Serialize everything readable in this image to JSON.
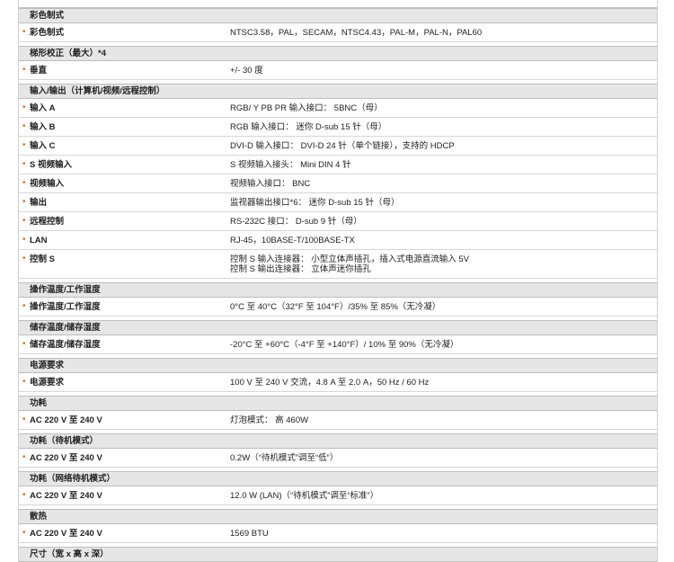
{
  "sections": [
    {
      "title": "彩色制式",
      "rows": [
        {
          "label": "彩色制式",
          "value": [
            "NTSC3.58，PAL，SECAM，NTSC4.43，PAL-M，PAL-N，PAL60"
          ]
        }
      ]
    },
    {
      "title": "梯形校正（最大）*4",
      "rows": [
        {
          "label": "垂直",
          "value": [
            "+/- 30 度"
          ]
        }
      ]
    },
    {
      "title": "输入/输出（计算机/视频/远程控制）",
      "rows": [
        {
          "label": "输入 A",
          "value": [
            "RGB/ Y PB PR 输入接口： 5BNC（母）"
          ]
        },
        {
          "label": "输入 B",
          "value": [
            "RGB 输入接口： 迷你 D-sub 15 针（母）"
          ]
        },
        {
          "label": "输入 C",
          "value": [
            "DVI-D 输入接口： DVI-D 24 针（单个链接），支持的 HDCP"
          ]
        },
        {
          "label": "S 视频输入",
          "value": [
            "S 视频输入接头： Mini DIN 4 针"
          ]
        },
        {
          "label": "视频输入",
          "value": [
            "视频输入接口： BNC"
          ]
        },
        {
          "label": "输出",
          "value": [
            "监视器输出接口*6： 迷你 D-sub 15 针（母）"
          ]
        },
        {
          "label": "远程控制",
          "value": [
            "RS-232C 接口： D-sub 9 针（母）"
          ]
        },
        {
          "label": "LAN",
          "value": [
            "RJ-45，10BASE-T/100BASE-TX"
          ]
        },
        {
          "label": "控制 S",
          "value": [
            "控制 S 输入连接器： 小型立体声插孔，插入式电源直流输入 5V",
            "控制 S 输出连接器： 立体声迷你插孔"
          ]
        }
      ]
    },
    {
      "title": "操作温度/工作湿度",
      "rows": [
        {
          "label": "操作温度/工作湿度",
          "value": [
            "0°C 至 40°C（32°F 至 104°F）/35% 至 85%（无冷凝）"
          ]
        }
      ]
    },
    {
      "title": "储存温度/储存湿度",
      "rows": [
        {
          "label": "储存温度/储存湿度",
          "value": [
            "-20°C 至 +60°C（-4°F 至 +140°F）/ 10% 至 90%（无冷凝）"
          ]
        }
      ]
    },
    {
      "title": "电源要求",
      "rows": [
        {
          "label": "电源要求",
          "value": [
            "100 V 至 240 V 交流，4.8 A 至 2.0 A，50 Hz / 60 Hz"
          ]
        }
      ]
    },
    {
      "title": "功耗",
      "rows": [
        {
          "label": "AC 220 V 至 240 V",
          "value": [
            "灯泡模式： 高 460W"
          ]
        }
      ]
    },
    {
      "title": "功耗（待机模式）",
      "rows": [
        {
          "label": "AC 220 V 至 240 V",
          "value": [
            "0.2W（“待机模式”调至“低”）"
          ]
        }
      ]
    },
    {
      "title": "功耗（网络待机模式）",
      "rows": [
        {
          "label": "AC 220 V 至 240 V",
          "value": [
            "12.0 W (LAN)（“待机模式”调至“标准”）"
          ]
        }
      ]
    },
    {
      "title": "散热",
      "rows": [
        {
          "label": "AC 220 V 至 240 V",
          "value": [
            "1569 BTU"
          ]
        }
      ]
    },
    {
      "title": "尺寸（宽 x 高 x 深）",
      "rows": []
    }
  ]
}
